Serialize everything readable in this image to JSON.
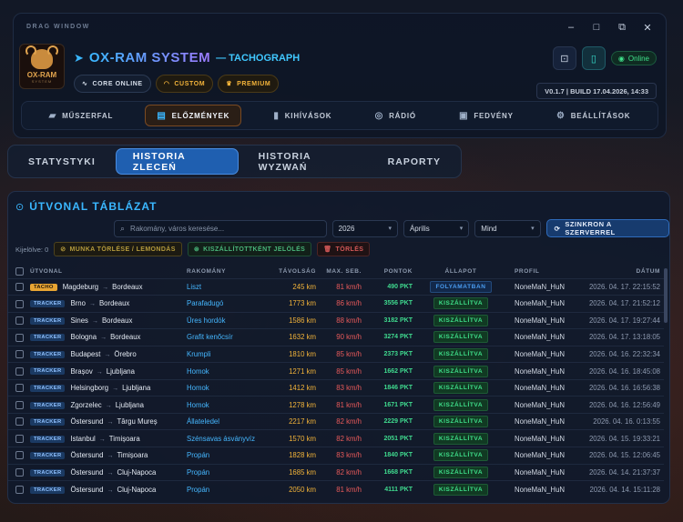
{
  "window": {
    "drag_label": "DRAG WINDOW",
    "controls": [
      "–",
      "□",
      "⧉",
      "✕"
    ]
  },
  "logo": {
    "line1": "OX-RAM",
    "line2": "SYSTEM"
  },
  "app": {
    "title": "OX-RAM SYSTEM",
    "subtitle": "— TACHOGRAPH"
  },
  "badges": [
    {
      "label": "CORE ONLINE"
    },
    {
      "label": "CUSTOM"
    },
    {
      "label": "PREMIUM"
    }
  ],
  "status": {
    "online": "Online"
  },
  "version": "V0.1.7 | BUILD 17.04.2026, 14:33",
  "nav": [
    {
      "label": "MŰSZERFAL",
      "icon": "truck-icon"
    },
    {
      "label": "ELŐZMÉNYEK",
      "icon": "book-icon"
    },
    {
      "label": "KIHÍVÁSOK",
      "icon": "chart-icon"
    },
    {
      "label": "RÁDIÓ",
      "icon": "radio-icon"
    },
    {
      "label": "FEDVÉNY",
      "icon": "overlay-icon"
    },
    {
      "label": "BEÁLLÍTÁSOK",
      "icon": "gear-icon"
    }
  ],
  "tabs": [
    "STATYSTYKI",
    "HISTORIA ZLECEŃ",
    "HISTORIA WYZWAŃ",
    "RAPORTY"
  ],
  "panel": {
    "title": "ÚTVONAL TÁBLÁZAT",
    "search_placeholder": "Rakomány, város keresése...",
    "year": "2026",
    "month": "Április",
    "filter": "Mind",
    "sync_label": "SZINKRON A SZERVERREL",
    "selected_label": "Kijelölve: 0",
    "btn_delete_job": "MUNKA TÖRLÉSE / LEMONDÁS",
    "btn_mark_delivered": "KISZÁLLÍTOTTKÉNT JELÖLÉS",
    "btn_delete": "TÖRLÉS"
  },
  "columns": [
    "ÚTVONAL",
    "RAKOMÁNY",
    "TÁVOLSÁG",
    "MAX. SEB.",
    "PONTOK",
    "ÁLLAPOT",
    "PROFIL",
    "DÁTUM"
  ],
  "rows": [
    {
      "src": "TACHO",
      "from": "Magdeburg",
      "to": "Bordeaux",
      "cargo": "Liszt",
      "dist": "245 km",
      "speed": "81 km/h",
      "pts": "490 PKT",
      "status": "FOLYAMATBAN",
      "profile": "NoneMaN_HuN",
      "date": "2026. 04. 17. 22:15:52"
    },
    {
      "src": "TRACKER",
      "from": "Brno",
      "to": "Bordeaux",
      "cargo": "Parafadugó",
      "dist": "1773 km",
      "speed": "86 km/h",
      "pts": "3556 PKT",
      "status": "KISZÁLLÍTVA",
      "profile": "NoneMaN_HuN",
      "date": "2026. 04. 17. 21:52:12"
    },
    {
      "src": "TRACKER",
      "from": "Sines",
      "to": "Bordeaux",
      "cargo": "Üres hordók",
      "dist": "1586 km",
      "speed": "88 km/h",
      "pts": "3182 PKT",
      "status": "KISZÁLLÍTVA",
      "profile": "NoneMaN_HuN",
      "date": "2026. 04. 17. 19:27:44"
    },
    {
      "src": "TRACKER",
      "from": "Bologna",
      "to": "Bordeaux",
      "cargo": "Grafit kenőcsír",
      "dist": "1632 km",
      "speed": "90 km/h",
      "pts": "3274 PKT",
      "status": "KISZÁLLÍTVA",
      "profile": "NoneMaN_HuN",
      "date": "2026. 04. 17. 13:18:05"
    },
    {
      "src": "TRACKER",
      "from": "Budapest",
      "to": "Örebro",
      "cargo": "Krumpli",
      "dist": "1810 km",
      "speed": "85 km/h",
      "pts": "2373 PKT",
      "status": "KISZÁLLÍTVA",
      "profile": "NoneMaN_HuN",
      "date": "2026. 04. 16. 22:32:34"
    },
    {
      "src": "TRACKER",
      "from": "Brașov",
      "to": "Ljubljana",
      "cargo": "Homok",
      "dist": "1271 km",
      "speed": "85 km/h",
      "pts": "1662 PKT",
      "status": "KISZÁLLÍTVA",
      "profile": "NoneMaN_HuN",
      "date": "2026. 04. 16. 18:45:08"
    },
    {
      "src": "TRACKER",
      "from": "Helsingborg",
      "to": "Ljubljana",
      "cargo": "Homok",
      "dist": "1412 km",
      "speed": "83 km/h",
      "pts": "1846 PKT",
      "status": "KISZÁLLÍTVA",
      "profile": "NoneMaN_HuN",
      "date": "2026. 04. 16. 16:56:38"
    },
    {
      "src": "TRACKER",
      "from": "Zgorzelec",
      "to": "Ljubljana",
      "cargo": "Homok",
      "dist": "1278 km",
      "speed": "81 km/h",
      "pts": "1671 PKT",
      "status": "KISZÁLLÍTVA",
      "profile": "NoneMaN_HuN",
      "date": "2026. 04. 16. 12:56:49"
    },
    {
      "src": "TRACKER",
      "from": "Östersund",
      "to": "Târgu Mureș",
      "cargo": "Állateledel",
      "dist": "2217 km",
      "speed": "82 km/h",
      "pts": "2229 PKT",
      "status": "KISZÁLLÍTVA",
      "profile": "NoneMaN_HuN",
      "date": "2026. 04. 16. 0:13:55"
    },
    {
      "src": "TRACKER",
      "from": "Istanbul",
      "to": "Timișoara",
      "cargo": "Szénsavas ásványvíz",
      "dist": "1570 km",
      "speed": "82 km/h",
      "pts": "2051 PKT",
      "status": "KISZÁLLÍTVA",
      "profile": "NoneMaN_HuN",
      "date": "2026. 04. 15. 19:33:21"
    },
    {
      "src": "TRACKER",
      "from": "Östersund",
      "to": "Timișoara",
      "cargo": "Propán",
      "dist": "1828 km",
      "speed": "83 km/h",
      "pts": "1840 PKT",
      "status": "KISZÁLLÍTVA",
      "profile": "NoneMaN_HuN",
      "date": "2026. 04. 15. 12:06:45"
    },
    {
      "src": "TRACKER",
      "from": "Östersund",
      "to": "Cluj-Napoca",
      "cargo": "Propán",
      "dist": "1685 km",
      "speed": "82 km/h",
      "pts": "1668 PKT",
      "status": "KISZÁLLÍTVA",
      "profile": "NoneMaN_HuN",
      "date": "2026. 04. 14. 21:37:37"
    },
    {
      "src": "TRACKER",
      "from": "Östersund",
      "to": "Cluj-Napoca",
      "cargo": "Propán",
      "dist": "2050 km",
      "speed": "81 km/h",
      "pts": "4111 PKT",
      "status": "KISZÁLLÍTVA",
      "profile": "NoneMaN_HuN",
      "date": "2026. 04. 14. 15:11:28"
    }
  ]
}
